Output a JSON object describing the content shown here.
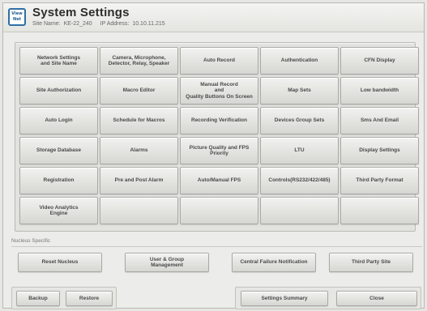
{
  "header": {
    "logo_text": "View\nNet",
    "title": "System Settings",
    "site_name_label": "Site Name:",
    "site_name": "KE-22_240",
    "ip_label": "IP Address:",
    "ip_address": "10.10.11.215"
  },
  "grid": {
    "buttons": [
      "Network Settings\nand Site Name",
      "Camera, Microphone,\nDetector, Relay, Speaker",
      "Auto Record",
      "Authentication",
      "CFN Display",
      "Site Authorization",
      "Macro Editor",
      "Manual Record\nand\nQuality Buttons On Screen",
      "Map Sets",
      "Low bandwidth",
      "Auto Login",
      "Schedule for Macros",
      "Recording Verification",
      "Devices Group Sets",
      "Sms And Email",
      "Storage Database",
      "Alarms",
      "Picture Quality and FPS\nPriority",
      "LTU",
      "Display Settings",
      "Registration",
      "Pre and Post Alarm",
      "Auto/Manual FPS",
      "Controls(RS232/422/485)",
      "Third Party Format",
      "Video Analytics\nEngine",
      "",
      "",
      "",
      ""
    ]
  },
  "nucleus": {
    "section_label": "Nucleus Specific",
    "reset_label": "Reset Nucleus",
    "user_group_label": "User & Group\nManagement",
    "central_failure_label": "Central Failure Notification",
    "third_party_site_label": "Third Party Site"
  },
  "footer": {
    "backup_label": "Backup",
    "restore_label": "Restore",
    "settings_summary_label": "Settings Summary",
    "close_label": "Close"
  }
}
